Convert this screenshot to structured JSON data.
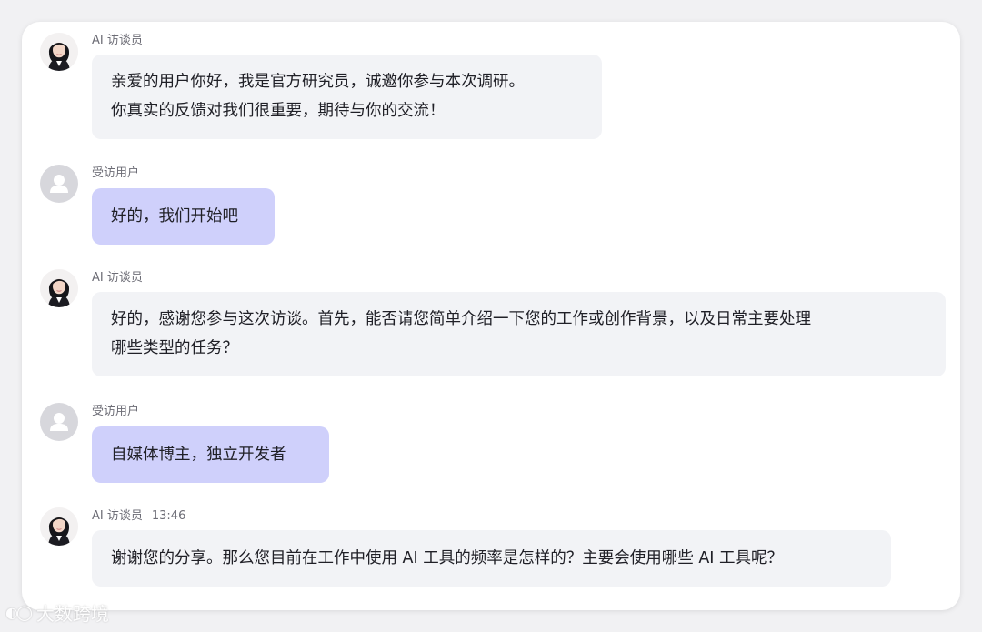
{
  "conversation": {
    "messages": [
      {
        "role": "ai",
        "sender": "AI 访谈员",
        "time": "",
        "lines": [
          "亲爱的用户你好，我是官方研究员，诚邀你参与本次调研。",
          "你真实的反馈对我们很重要，期待与你的交流！"
        ]
      },
      {
        "role": "user",
        "sender": "受访用户",
        "time": "",
        "lines": [
          "好的，我们开始吧"
        ]
      },
      {
        "role": "ai",
        "sender": "AI 访谈员",
        "time": "",
        "lines": [
          "好的，感谢您参与这次访谈。首先，能否请您简单介绍一下您的工作或创作背景，以及日常主要处理",
          "哪些类型的任务？"
        ]
      },
      {
        "role": "user",
        "sender": "受访用户",
        "time": "",
        "lines": [
          "自媒体博主，独立开发者"
        ]
      },
      {
        "role": "ai",
        "sender": "AI 访谈员",
        "time": "13:46",
        "lines": [
          "谢谢您的分享。那么您目前在工作中使用 AI 工具的频率是怎样的？主要会使用哪些 AI 工具呢？"
        ]
      }
    ]
  },
  "watermark": {
    "text": "大数跨境"
  },
  "colors": {
    "ai_bubble": "#f2f3f6",
    "user_bubble": "#cfd0fb",
    "sender_text": "#6d6d76",
    "body_text": "#202027"
  }
}
